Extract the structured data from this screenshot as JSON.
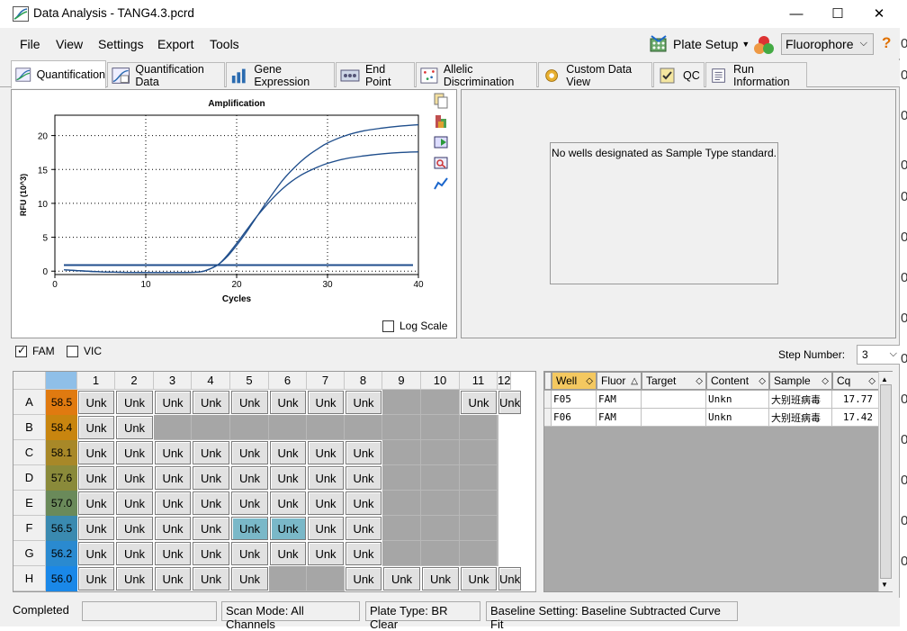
{
  "window": {
    "title": "Data Analysis - TANG4.3.pcrd",
    "minimize": "—",
    "maximize": "☐",
    "close": "✕"
  },
  "menu": [
    "File",
    "View",
    "Settings",
    "Export",
    "Tools"
  ],
  "toolbar": {
    "plate_setup": "Plate Setup",
    "fluorophore": "Fluorophore",
    "help": "?"
  },
  "tabs": [
    "Quantification",
    "Quantification Data",
    "Gene Expression",
    "End Point",
    "Allelic Discrimination",
    "Custom Data View",
    "QC",
    "Run Information"
  ],
  "chart_data": {
    "type": "line",
    "title": "Amplification",
    "xlabel": "Cycles",
    "ylabel": "RFU (10^3)",
    "xlim": [
      0,
      40
    ],
    "ylim": [
      -0.5,
      23
    ],
    "xticks": [
      0,
      10,
      20,
      30,
      40
    ],
    "yticks": [
      0,
      5,
      10,
      15,
      20
    ],
    "grid": true,
    "log_scale_label": "Log Scale",
    "threshold": 0.9,
    "series_color": "#1f4e8c",
    "series": [
      {
        "x": [
          1,
          5,
          10,
          14,
          16,
          17,
          18,
          19,
          20,
          21,
          22,
          23,
          24,
          25,
          26,
          27,
          28,
          29,
          30,
          32,
          34,
          36,
          38,
          40
        ],
        "y": [
          0.2,
          -0.1,
          -0.2,
          -0.2,
          -0.1,
          0.3,
          1.0,
          2.2,
          3.8,
          5.6,
          7.6,
          9.6,
          11.5,
          13.3,
          14.8,
          16.1,
          17.2,
          18.1,
          18.9,
          20.0,
          20.7,
          21.1,
          21.4,
          21.6
        ]
      },
      {
        "x": [
          1,
          5,
          10,
          14,
          16,
          17,
          18,
          19,
          20,
          21,
          22,
          23,
          24,
          25,
          26,
          27,
          28,
          29,
          30,
          32,
          34,
          36,
          38,
          40
        ],
        "y": [
          0.2,
          -0.1,
          -0.2,
          -0.2,
          -0.1,
          0.3,
          1.0,
          2.4,
          4.1,
          5.9,
          7.7,
          9.3,
          10.8,
          12.1,
          13.2,
          14.1,
          14.8,
          15.4,
          15.9,
          16.6,
          17.0,
          17.3,
          17.5,
          17.6
        ]
      }
    ]
  },
  "standards_message": "No wells designated as Sample Type standard.",
  "fluor_checks": [
    {
      "label": "FAM",
      "checked": true
    },
    {
      "label": "VIC",
      "checked": false
    }
  ],
  "step": {
    "label": "Step Number:",
    "value": "3"
  },
  "plate": {
    "columns": [
      "1",
      "2",
      "3",
      "4",
      "5",
      "6",
      "7",
      "8",
      "9",
      "10",
      "11",
      "12"
    ],
    "rows": [
      "A",
      "B",
      "C",
      "D",
      "E",
      "F",
      "G",
      "H"
    ],
    "temps": [
      "58.5",
      "58.4",
      "58.1",
      "57.6",
      "57.0",
      "56.5",
      "56.2",
      "56.0"
    ],
    "temp_colors": [
      "#e07a10",
      "#c8850f",
      "#a88828",
      "#8a8a3a",
      "#6a8a5a",
      "#3a8ab0",
      "#2a8ad0",
      "#1a88e8"
    ],
    "unk": "Unk",
    "wells": [
      [
        1,
        1,
        1,
        1,
        1,
        1,
        1,
        1,
        0,
        0,
        1,
        1
      ],
      [
        1,
        1,
        0,
        0,
        0,
        0,
        0,
        0,
        0,
        0,
        0,
        0
      ],
      [
        1,
        1,
        1,
        1,
        1,
        1,
        1,
        1,
        0,
        0,
        0,
        0
      ],
      [
        1,
        1,
        1,
        1,
        1,
        1,
        1,
        1,
        0,
        0,
        0,
        0
      ],
      [
        1,
        1,
        1,
        1,
        1,
        1,
        1,
        1,
        0,
        0,
        0,
        0
      ],
      [
        1,
        1,
        1,
        1,
        2,
        2,
        1,
        1,
        0,
        0,
        0,
        0
      ],
      [
        1,
        1,
        1,
        1,
        1,
        1,
        1,
        1,
        0,
        0,
        0,
        0
      ],
      [
        1,
        1,
        1,
        1,
        1,
        0,
        0,
        1,
        1,
        1,
        1,
        1
      ]
    ]
  },
  "table": {
    "headers": [
      "Well",
      "Fluor",
      "Target",
      "Content",
      "Sample",
      "Cq"
    ],
    "rows": [
      [
        "F05",
        "FAM",
        "",
        "Unkn",
        "大别班病毒",
        "17.77"
      ],
      [
        "F06",
        "FAM",
        "",
        "Unkn",
        "大别班病毒",
        "17.42"
      ]
    ]
  },
  "status": {
    "state": "Completed",
    "scan_mode": "Scan Mode: All Channels",
    "plate_type": "Plate Type: BR Clear",
    "baseline": "Baseline Setting: Baseline Subtracted Curve Fit"
  }
}
